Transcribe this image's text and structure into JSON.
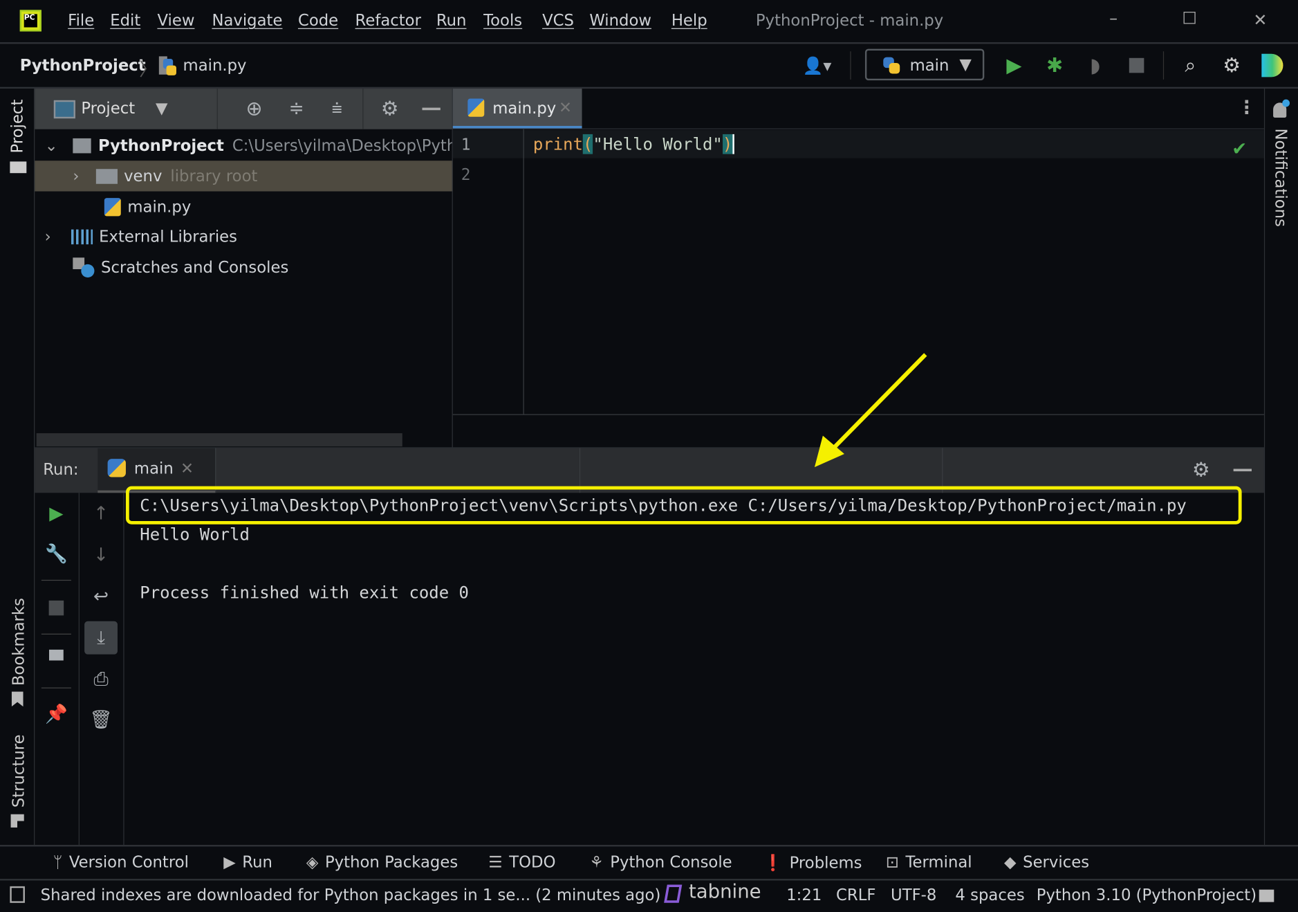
{
  "window": {
    "title": "PythonProject - main.py",
    "logo": "PC",
    "controls": {
      "minimize": "–",
      "maximize": "☐",
      "close": "✕"
    }
  },
  "menu": [
    "File",
    "Edit",
    "View",
    "Navigate",
    "Code",
    "Refactor",
    "Run",
    "Tools",
    "VCS",
    "Window",
    "Help"
  ],
  "breadcrumb": {
    "project": "PythonProject",
    "file": "main.py"
  },
  "toolbar": {
    "run_config": "main"
  },
  "left_strip": {
    "project": "Project",
    "bookmarks": "Bookmarks",
    "structure": "Structure"
  },
  "right_strip": {
    "notifications": "Notifications"
  },
  "project_panel": {
    "title": "Project",
    "tree": [
      {
        "label": "PythonProject",
        "hint": "C:\\Users\\yilma\\Desktop\\Python"
      },
      {
        "label": "venv",
        "hint": "library root"
      },
      {
        "label": "main.py"
      },
      {
        "label": "External Libraries"
      },
      {
        "label": "Scratches and Consoles"
      }
    ]
  },
  "editor": {
    "tab": "main.py",
    "line_numbers": [
      "1",
      "2"
    ],
    "code": {
      "func": "print",
      "lparen": "(",
      "string": "\"Hello World\"",
      "rparen": ")"
    }
  },
  "run_panel": {
    "label": "Run:",
    "tab": "main",
    "output": [
      "C:\\Users\\yilma\\Desktop\\PythonProject\\venv\\Scripts\\python.exe C:/Users/yilma/Desktop/PythonProject/main.py",
      "Hello World",
      "Process finished with exit code 0"
    ]
  },
  "bottom_tools": [
    "Version Control",
    "Run",
    "Python Packages",
    "TODO",
    "Python Console",
    "Problems",
    "Terminal",
    "Services"
  ],
  "status": {
    "message": "Shared indexes are downloaded for Python packages in 1 se... (2 minutes ago)",
    "tabnine": "tabnine",
    "position": "1:21",
    "line_sep": "CRLF",
    "encoding": "UTF-8",
    "indent": "4 spaces",
    "interpreter": "Python 3.10 (PythonProject)"
  },
  "colors": {
    "annotation": "#f5f000",
    "run": "#4caf50",
    "accent": "#4a88c7"
  }
}
